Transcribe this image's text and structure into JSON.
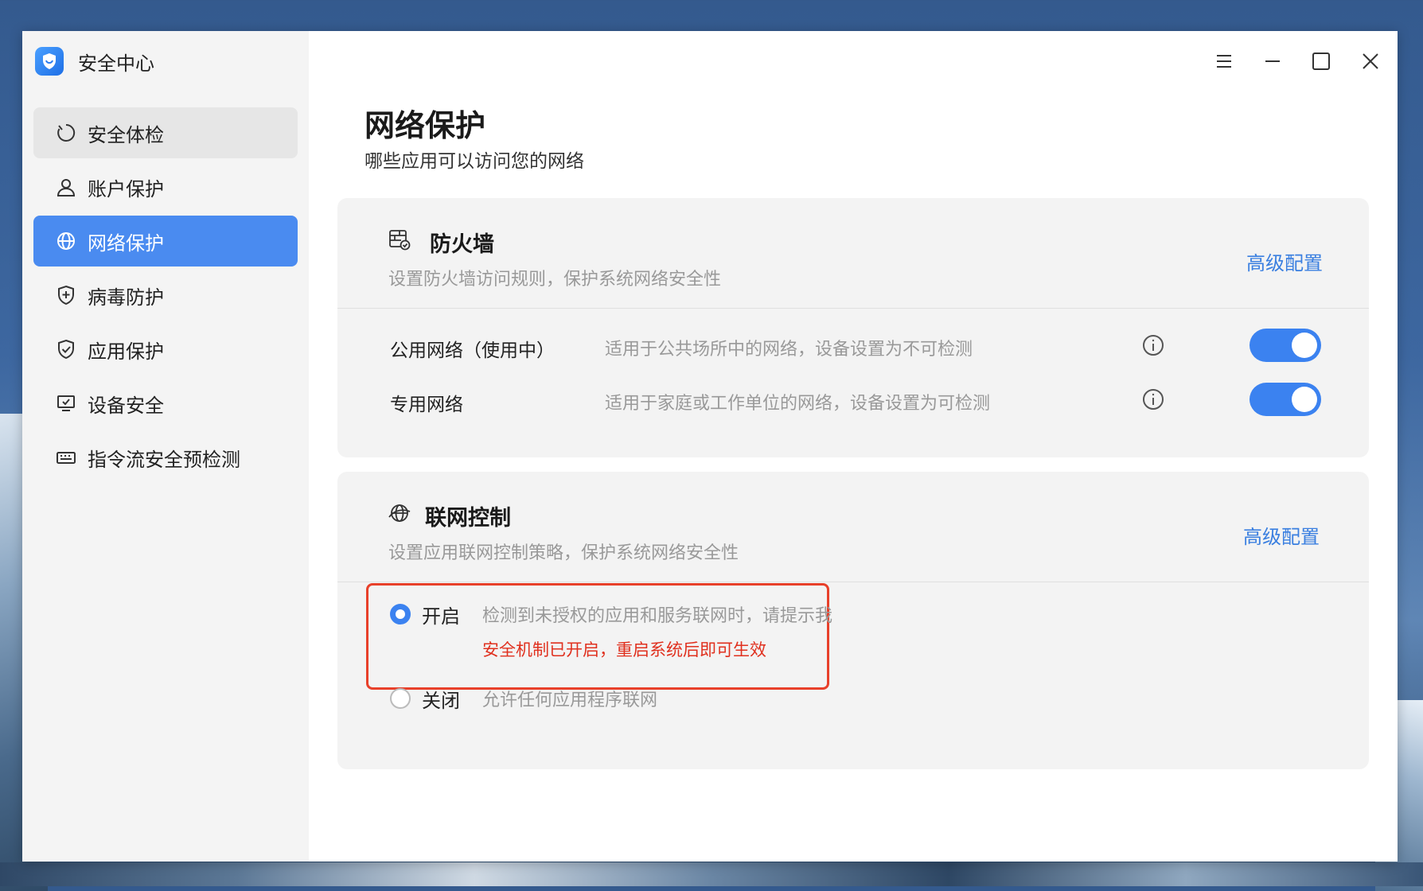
{
  "app": {
    "title": "安全中心"
  },
  "sidebar": {
    "items": [
      {
        "label": "安全体检",
        "icon": "scan-icon",
        "state": "hover"
      },
      {
        "label": "账户保护",
        "icon": "user-icon",
        "state": "normal"
      },
      {
        "label": "网络保护",
        "icon": "globe-icon",
        "state": "active"
      },
      {
        "label": "病毒防护",
        "icon": "shield-plus-icon",
        "state": "normal"
      },
      {
        "label": "应用保护",
        "icon": "shield-check-icon",
        "state": "normal"
      },
      {
        "label": "设备安全",
        "icon": "monitor-check-icon",
        "state": "normal"
      },
      {
        "label": "指令流安全预检测",
        "icon": "keyboard-icon",
        "state": "normal"
      }
    ]
  },
  "window_controls": [
    "menu-icon",
    "minimize-icon",
    "maximize-icon",
    "close-icon"
  ],
  "main": {
    "title": "网络保护",
    "subtitle": "哪些应用可以访问您的网络",
    "firewall": {
      "title": "防火墙",
      "desc": "设置防火墙访问规则，保护系统网络安全性",
      "advanced": "高级配置",
      "networks": [
        {
          "name": "公用网络（使用中）",
          "desc": "适用于公共场所中的网络，设备设置为不可检测",
          "enabled": true
        },
        {
          "name": "专用网络",
          "desc": "适用于家庭或工作单位的网络，设备设置为可检测",
          "enabled": true
        }
      ]
    },
    "netcontrol": {
      "title": "联网控制",
      "desc": "设置应用联网控制策略，保护系统网络安全性",
      "advanced": "高级配置",
      "options": [
        {
          "label": "开启",
          "desc": "检测到未授权的应用和服务联网时，请提示我",
          "warning": "安全机制已开启，重启系统后即可生效",
          "checked": true
        },
        {
          "label": "关闭",
          "desc": "允许任何应用程序联网",
          "checked": false
        }
      ]
    }
  },
  "colors": {
    "accent": "#3b82f0",
    "warning": "#e0301e",
    "highlight_border": "#e8402a"
  }
}
